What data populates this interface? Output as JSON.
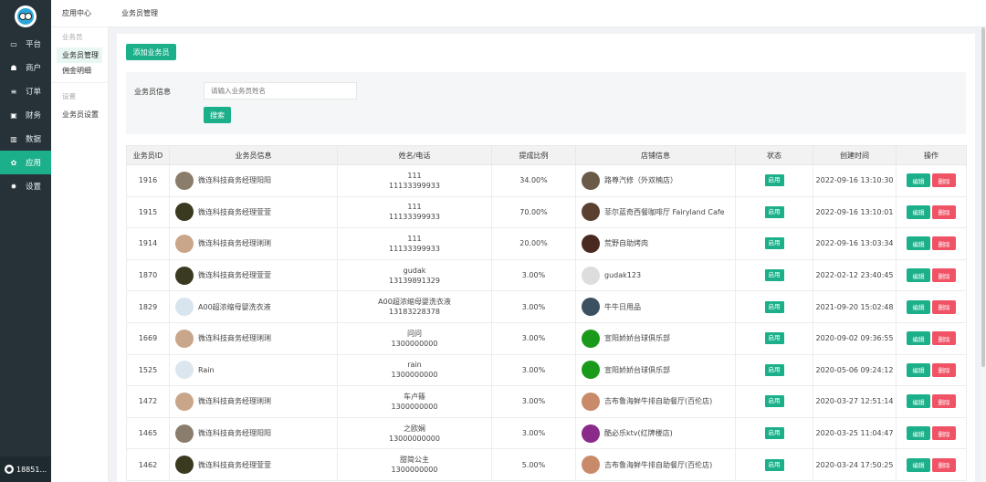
{
  "sidebar": {
    "items": [
      {
        "label": "平台",
        "icon": "monitor-icon",
        "glyph": "▭"
      },
      {
        "label": "商户",
        "icon": "users-icon",
        "glyph": "☗"
      },
      {
        "label": "订单",
        "icon": "list-icon",
        "glyph": "≡"
      },
      {
        "label": "财务",
        "icon": "money-icon",
        "glyph": "▣"
      },
      {
        "label": "数据",
        "icon": "chart-icon",
        "glyph": "▥"
      },
      {
        "label": "应用",
        "icon": "apps-icon",
        "glyph": "✿"
      },
      {
        "label": "设置",
        "icon": "gear-icon",
        "glyph": "✹"
      }
    ],
    "active_index": 5,
    "user": "18851..."
  },
  "submenu": {
    "group1": "业务员",
    "links1": [
      "业务员管理",
      "佣金明细"
    ],
    "group2": "设置",
    "links2": [
      "业务员设置"
    ]
  },
  "topbar": {
    "crumb1": "应用中心",
    "crumb2": "业务员管理"
  },
  "toolbar": {
    "add_label": "添加业务员"
  },
  "filter": {
    "label": "业务员信息",
    "placeholder": "请输入业务员姓名",
    "search_label": "搜索"
  },
  "table": {
    "headers": [
      "业务员ID",
      "业务员信息",
      "姓名/电话",
      "提成比例",
      "店铺信息",
      "状态",
      "创建时间",
      "操作"
    ],
    "edit_label": "编辑",
    "delete_label": "删除",
    "rows": [
      {
        "id": "1916",
        "info": "微连科技商务经理阳阳",
        "name": "111",
        "phone": "11133399933",
        "rate": "34.00%",
        "shop": "路尊汽修（外双楠店）",
        "status": "启用",
        "time": "2022-09-16 13:10:30",
        "av": "#8b7d6b",
        "shop_av": "#6b5a48"
      },
      {
        "id": "1915",
        "info": "微连科技商务经理萱萱",
        "name": "111",
        "phone": "11133399933",
        "rate": "70.00%",
        "shop": "菲尔蓝奇西餐咖啡厅 Fairyland Cafe",
        "status": "启用",
        "time": "2022-09-16 13:10:01",
        "av": "#3a3a20",
        "shop_av": "#5a4030"
      },
      {
        "id": "1914",
        "info": "微连科技商务经理琍琍",
        "name": "111",
        "phone": "11133399933",
        "rate": "20.00%",
        "shop": "荒野自助烤肉",
        "status": "启用",
        "time": "2022-09-16 13:03:34",
        "av": "#c9a68a",
        "shop_av": "#4a2a20"
      },
      {
        "id": "1870",
        "info": "微连科技商务经理萱萱",
        "name": "gudak",
        "phone": "13139891329",
        "rate": "3.00%",
        "shop": "gudak123",
        "status": "启用",
        "time": "2022-02-12 23:40:45",
        "av": "#3a3a20",
        "shop_av": "#dddddd"
      },
      {
        "id": "1829",
        "info": "A00超浓缩母婴洗衣液",
        "name": "A00超浓缩母婴洗衣液",
        "phone": "13183228378",
        "rate": "3.00%",
        "shop": "牛牛日用品",
        "status": "启用",
        "time": "2021-09-20 15:02:48",
        "av": "#d8e4ee",
        "shop_av": "#3b5060"
      },
      {
        "id": "1669",
        "info": "微连科技商务经理琍琍",
        "name": "问问",
        "phone": "1300000000",
        "rate": "3.00%",
        "shop": "宣阳娇娇台球俱乐部",
        "status": "启用",
        "time": "2020-09-02 09:36:55",
        "av": "#c9a68a",
        "shop_av": "#1a9a1a"
      },
      {
        "id": "1525",
        "info": "Rain",
        "name": "rain",
        "phone": "1300000000",
        "rate": "3.00%",
        "shop": "宣阳娇娇台球俱乐部",
        "status": "启用",
        "time": "2020-05-06 09:24:12",
        "av": "#dce6ee",
        "shop_av": "#1a9a1a"
      },
      {
        "id": "1472",
        "info": "微连科技商务经理琍琍",
        "name": "车卢篠",
        "phone": "1300000000",
        "rate": "3.00%",
        "shop": "吉布鲁海鲜牛排自助餐厅(百伦店)",
        "status": "启用",
        "time": "2020-03-27 12:51:14",
        "av": "#c9a68a",
        "shop_av": "#c98a6a"
      },
      {
        "id": "1465",
        "info": "微连科技商务经理阳阳",
        "name": "之欧娴",
        "phone": "13000000000",
        "rate": "3.00%",
        "shop": "酷必乐ktv(红牌楼店)",
        "status": "启用",
        "time": "2020-03-25 11:04:47",
        "av": "#8b7d6b",
        "shop_av": "#8a2a8a"
      },
      {
        "id": "1462",
        "info": "微连科技商务经理萱萱",
        "name": "甜简公主",
        "phone": "1300000000",
        "rate": "5.00%",
        "shop": "吉布鲁海鲜牛排自助餐厅(百伦店)",
        "status": "启用",
        "time": "2020-03-24 17:50:25",
        "av": "#3a3a20",
        "shop_av": "#c98a6a"
      }
    ]
  }
}
